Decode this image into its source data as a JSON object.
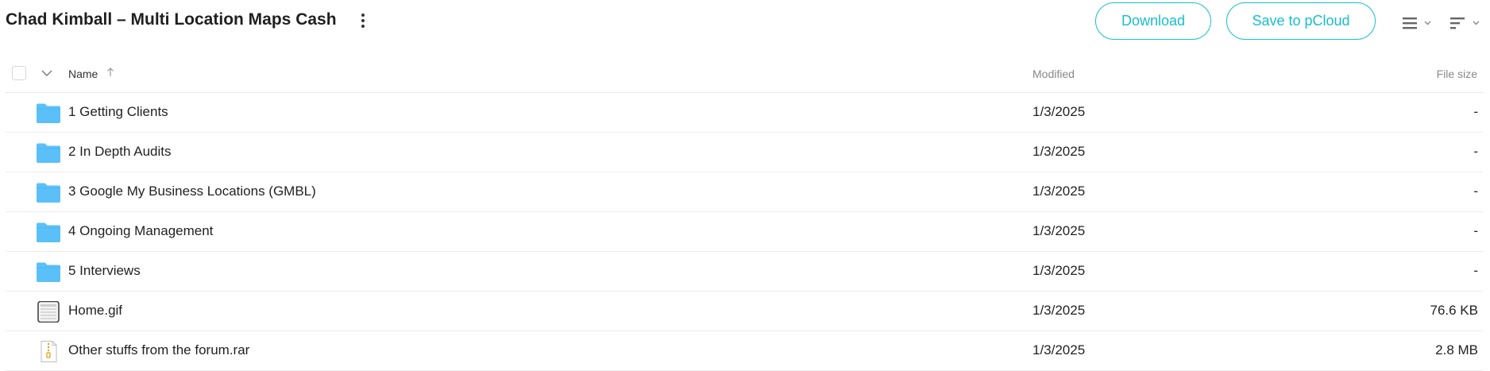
{
  "header": {
    "title": "Chad Kimball – Multi Location Maps Cash",
    "download_label": "Download",
    "save_label": "Save to pCloud"
  },
  "columns": {
    "name": "Name",
    "modified": "Modified",
    "size": "File size"
  },
  "colors": {
    "accent": "#17bed0",
    "folder": "#5bc0f8"
  },
  "rows": [
    {
      "name": "1 Getting Clients",
      "modified": "1/3/2025",
      "size": "-",
      "icon": "folder-icon"
    },
    {
      "name": "2 In Depth Audits",
      "modified": "1/3/2025",
      "size": "-",
      "icon": "folder-icon"
    },
    {
      "name": "3 Google My Business Locations (GMBL)",
      "modified": "1/3/2025",
      "size": "-",
      "icon": "folder-icon"
    },
    {
      "name": "4 Ongoing Management",
      "modified": "1/3/2025",
      "size": "-",
      "icon": "folder-icon"
    },
    {
      "name": "5 Interviews",
      "modified": "1/3/2025",
      "size": "-",
      "icon": "folder-icon"
    },
    {
      "name": "Home.gif",
      "modified": "1/3/2025",
      "size": "76.6 KB",
      "icon": "image-file-icon"
    },
    {
      "name": "Other stuffs from the forum.rar",
      "modified": "1/3/2025",
      "size": "2.8 MB",
      "icon": "archive-file-icon"
    }
  ]
}
